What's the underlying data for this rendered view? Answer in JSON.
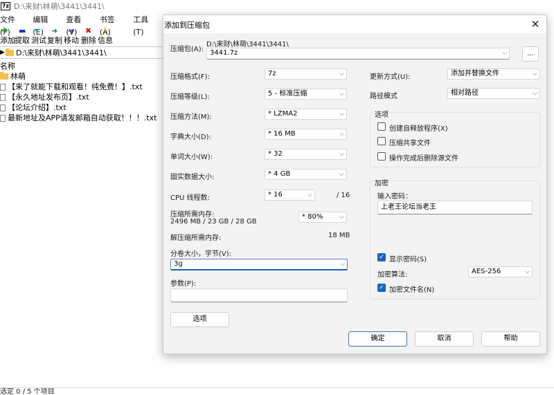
{
  "bg_window": {
    "title": "D:\\来财\\林萌\\3441\\3441\\",
    "app_icon_text": "7z",
    "menu": [
      "文件(F)",
      "编辑(E)",
      "查看(V)",
      "书签(A)",
      "工具(T)"
    ],
    "toolbar": [
      {
        "icon": "add-icon",
        "glyph": "✚",
        "color": "#1aa31a",
        "label": "添加"
      },
      {
        "icon": "extract-icon",
        "glyph": "▬",
        "color": "#1a2fbf",
        "label": "提取"
      },
      {
        "icon": "test-icon",
        "glyph": "▼",
        "color": "#17a9a9",
        "label": "测试"
      },
      {
        "icon": "copy-icon",
        "glyph": "➜",
        "color": "#1a7a3a",
        "label": "复制"
      },
      {
        "icon": "move-icon",
        "glyph": "➜",
        "color": "#1a2a8f",
        "label": "移动"
      },
      {
        "icon": "delete-icon",
        "glyph": "✖",
        "color": "#d01010",
        "label": "删除"
      },
      {
        "icon": "info-icon",
        "glyph": "i",
        "color": "#c9a400",
        "label": "信息"
      }
    ],
    "path": "D:\\来财\\林萌\\3441\\3441\\",
    "column_header": "名称",
    "files": [
      {
        "type": "folder",
        "name": "林萌"
      },
      {
        "type": "file",
        "name": "【来了就能下载和观看！纯免费！】.txt"
      },
      {
        "type": "file",
        "name": "【永久地址发布页】.txt"
      },
      {
        "type": "file",
        "name": "【论坛介绍】.txt"
      },
      {
        "type": "file",
        "name": "最新地址及APP请发邮箱自动获取！！！.txt"
      }
    ],
    "status": "选定 0 / 5 个项目"
  },
  "dialog": {
    "title": "添加到压缩包",
    "close_glyph": "✕",
    "archive_label": "压缩包(A):",
    "archive_path": "D:\\来财\\林萌\\3441\\3441\\",
    "archive_name": "3441.7z",
    "browse_label": "...",
    "format_label": "压缩格式(F):",
    "format_value": "7z",
    "level_label": "压缩等级(L):",
    "level_value": "5 - 标准压缩",
    "method_label": "压缩方法(M):",
    "method_value": "* LZMA2",
    "dict_label": "字典大小(D):",
    "dict_value": "* 16 MB",
    "word_label": "单词大小(W):",
    "word_value": "* 32",
    "solid_label": "固实数据大小:",
    "solid_value": "* 4 GB",
    "threads_label": "CPU 线程数:",
    "threads_value": "* 16",
    "threads_max": "/ 16",
    "mem_label": "压缩所需内存:",
    "mem_value": "2496 MB / 23 GB / 28 GB",
    "mem_percent": "* 80%",
    "decomp_label": "解压缩所需内存:",
    "decomp_value": "18 MB",
    "split_label": "分卷大小，字节(V):",
    "split_value": "3g",
    "params_label": "参数(P):",
    "params_value": "",
    "options_button": "选项",
    "update_label": "更新方式(U):",
    "update_value": "添加并替换文件",
    "pathmode_label": "路径模式",
    "pathmode_value": "相对路径",
    "options_group": "选项",
    "opt_sfx": "创建自释放程序(X)",
    "opt_shared": "压缩共享文件",
    "opt_delete": "操作完成后删除源文件",
    "enc_group": "加密",
    "pwd_label": "输入密码：",
    "pwd_value": "上老王论坛当老王",
    "show_pwd": "显示密码(S)",
    "enc_method_label": "加密算法:",
    "enc_method_value": "AES-256",
    "enc_names": "加密文件名(N)",
    "ok_button": "确定",
    "cancel_button": "取消",
    "help_button": "帮助"
  }
}
